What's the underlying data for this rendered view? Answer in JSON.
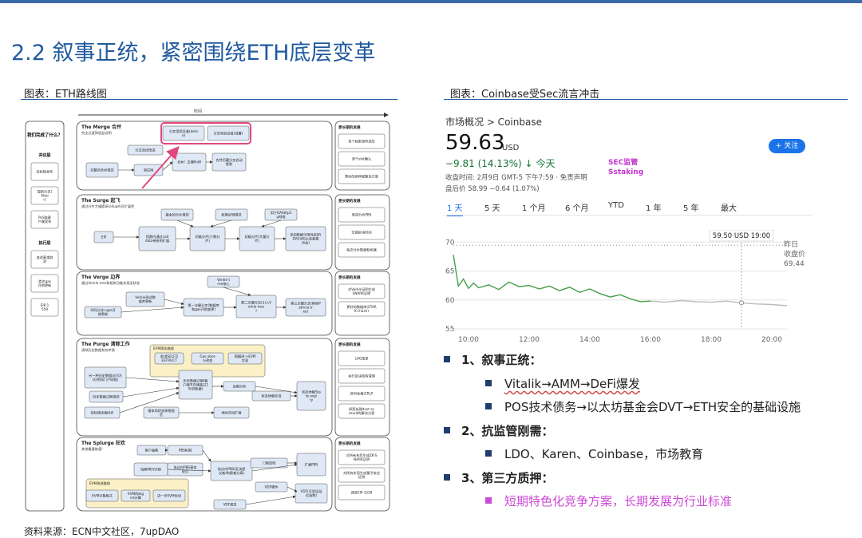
{
  "slide": {
    "title": "2.2 叙事正统，紧密围绕ETH底层变革",
    "left_label": "图表：ETH路线图",
    "right_label": "图表：Coinbase受Sec流言冲击",
    "source": "资料来源：ECN中文社区，7upDAO"
  },
  "roadmap": {
    "timeline_label": "时间",
    "side": {
      "header": "我们完成了什么？",
      "group1_title": "共识层",
      "group1_items": [
        "信标链发布",
        "提前分叉(Altair)",
        "PoS链客户端发布"
      ],
      "group2_title": "执行层",
      "group2_items": [
        "追述基本取消",
        "首次gas开销更新",
        "EIP-1559"
      ]
    },
    "right_header": "更长期的发展",
    "colors": {
      "box": "#dfe8f5",
      "border": "#555555",
      "highlight": "#e0467f",
      "evm": "#fbf0c6"
    },
    "sections": [
      {
        "name": "The Merge 合并",
        "sub": "完全过渡到权益证明",
        "boxes": [
          "分叉型验证者(demo)",
          "分叉型验证者(部署)",
          "分叉选择改进",
          "合并！支撑PoW",
          "合并后硬分叉启动提款",
          "完整的合并规范",
          "测试网"
        ],
        "right": [
          "单个秘密领导选举",
          "单个slot确认",
          "更好的质押者聚合方案"
        ]
      },
      {
        "name": "The Surge 起飞",
        "sub": "通过分片大幅提高rollup的可扩展性",
        "boxes": [
          "基本的分片规范",
          "权限证明规范",
          "用于DAS的p2p网络",
          "EIP",
          "短期内通过calldata带来的扩展",
          "初级分片(少数分片)",
          "初级分片(大量分片)",
          "添加数据可用性采样(DAS)(防止恶意委员会)"
        ],
        "right": [
          "改进分片PBS",
          "交错区块时间",
          "每次分片数据和机器"
        ]
      },
      {
        "name": "The Verge 边界",
        "sub": "通过Verkle tree和相关功能实现无状态",
        "boxes": [
          "Verkle tree核心",
          "Verkle测试数据库更新",
          "代码分块+gas开销更新",
          "第一次硬分叉(数据库和gas开销变更)",
          "第二次硬分叉(引入Verkle tree)",
          "第三次硬分叉(移除Patricia tree)"
        ],
        "right": [
          "对Verkle证明生成SNARK证明",
          "更好的数据库(STARK+hash)"
        ]
      },
      {
        "name": "The Purge 清除工作",
        "sub": "清除历史数据和技术债",
        "boxes": [
          "EVM简化路线",
          "取消SELFDESTRUCT",
          "Gas observ改变",
          "预编译->EVM实现",
          "另一种历史数据访问方式(例如门户网络)",
          "历史数据过期规范",
          "信标链快速同步",
          "历史数据过期(客户端不存储超过1年的数据)",
          "后期分析",
          "基本的状态休眠规范",
          "状态休眠实现",
          "地址空间扩展",
          "状态休眠State expiry"
        ],
        "right": [
          "LOG改革",
          "执行区块结构清理",
          "序列化格式RLP",
          "探索处理dust account的解决方案"
        ]
      },
      {
        "name": "The Splurge 狂欢",
        "sub": "其他重要修复!",
        "boxes": [
          "账户抽象",
          "PBS机制",
          "短期MEV迁移",
          "协议内PBS基本规范",
          "协议内PBS(区块提议者/构建者分离)",
          "门限加密",
          "扩展PBS",
          "VDF硬件",
          "VDF规范",
          "VDF(可验证延迟函数)",
          "EVM改进路线",
          "EVM对象格式",
          "EVM的bigint计算",
          "进一步EVM优化"
        ],
        "right": [
          "对所有东西生成ZK-SNARK证明",
          "对所有东西生成量子安全证明",
          "改进EIP-1559"
        ]
      }
    ]
  },
  "widget": {
    "breadcrumb": "市场概况 > Coinbase",
    "price": "59.63",
    "currency": "USD",
    "change": "−9.81 (14.13%)",
    "change_dir": "↓",
    "change_period": "今天",
    "meta1": "收盘时间: 2月9日 GMT-5 下午7:59 · 免责声明",
    "meta2": "盘后价 58.99 −0.64 (1.07%)",
    "annotation_line1": "SEC监管",
    "annotation_line2": "Sstaking",
    "follow_label": "+ 关注",
    "tabs": [
      "1 天",
      "5 天",
      "1 个月",
      "6 个月",
      "YTD",
      "1 年",
      "5 年",
      "最大"
    ],
    "active_tab": "1 天",
    "tooltip": "59.50 USD  19:00",
    "prev_close_label_1": "昨日",
    "prev_close_label_2": "收盘价",
    "prev_close_value": "69.44",
    "colors": {
      "accent": "#1a73e8",
      "down": "#137333",
      "line": "#43a047",
      "after_hours": "#bbbbbb",
      "annotation": "#c233d0"
    }
  },
  "chart_data": {
    "type": "line",
    "x_ticks": [
      "10:00",
      "12:00",
      "14:00",
      "16:00",
      "18:00",
      "20:00"
    ],
    "y_ticks": [
      55,
      60,
      65,
      70
    ],
    "ylim": [
      55,
      71
    ],
    "xlim": [
      "09:30",
      "20:30"
    ],
    "previous_close": 69.44,
    "series": [
      {
        "session": "regular",
        "x": [
          "09:30",
          "09:40",
          "09:50",
          "10:00",
          "10:10",
          "10:20",
          "10:40",
          "11:00",
          "11:20",
          "11:40",
          "12:00",
          "12:20",
          "12:40",
          "13:00",
          "13:20",
          "13:40",
          "14:00",
          "14:20",
          "14:40",
          "15:00",
          "15:20",
          "15:40",
          "16:00"
        ],
        "y": [
          67.8,
          62.4,
          63.6,
          62.0,
          62.9,
          62.1,
          62.6,
          61.8,
          63.1,
          62.3,
          62.5,
          61.9,
          62.4,
          61.6,
          62.2,
          61.3,
          61.9,
          61.1,
          60.5,
          60.9,
          60.2,
          59.7,
          59.8
        ]
      },
      {
        "session": "after-hours",
        "x": [
          "16:00",
          "16:30",
          "17:00",
          "17:30",
          "18:00",
          "18:30",
          "19:00",
          "19:30",
          "20:00",
          "20:30"
        ],
        "y": [
          59.8,
          59.6,
          59.9,
          59.7,
          59.6,
          59.8,
          59.5,
          59.3,
          59.2,
          59.0
        ]
      }
    ]
  },
  "bullets": [
    {
      "text": "1、叙事正统："
    },
    {
      "sub": true,
      "text": "Vitalik→AMM→DeFi爆发"
    },
    {
      "sub": true,
      "text": "POS技术债务→以太坊基金会DVT→ETH安全的基础设施"
    },
    {
      "text": "2、抗监管刚需："
    },
    {
      "sub": true,
      "text": "LDO、Karen、Coinbase，市场教育"
    },
    {
      "text": "3、第三方质押："
    },
    {
      "sub": true,
      "text": "短期特色化竞争方案，长期发展为行业标准"
    }
  ]
}
